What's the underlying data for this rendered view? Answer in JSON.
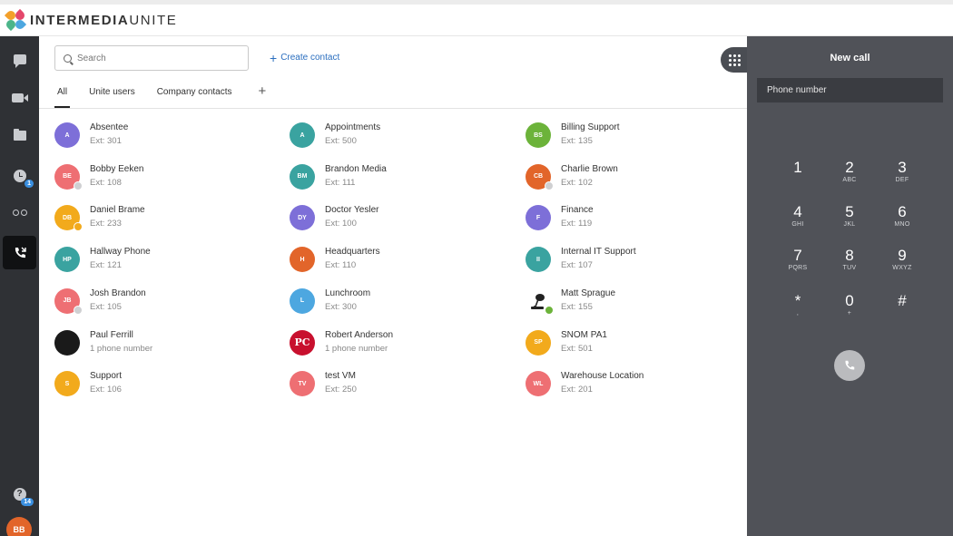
{
  "app": {
    "brand_bold": "INTERMEDIA",
    "brand_light": "UNITE"
  },
  "nav": {
    "recents_badge": "1",
    "help_badge": "14",
    "user_initials": "BB"
  },
  "search": {
    "placeholder": "Search",
    "value": ""
  },
  "create_contact_label": "Create contact",
  "tabs": [
    {
      "label": "All",
      "active": true
    },
    {
      "label": "Unite users"
    },
    {
      "label": "Company contacts"
    }
  ],
  "tab_add_label": "+",
  "contacts": [
    {
      "name": "Absentee",
      "sub": "Ext: 301",
      "initials": "A",
      "color": "#7d6fd8"
    },
    {
      "name": "Appointments",
      "sub": "Ext: 500",
      "initials": "A",
      "color": "#3aa3a0"
    },
    {
      "name": "Billing Support",
      "sub": "Ext: 135",
      "initials": "BS",
      "color": "#6cb33a"
    },
    {
      "name": "Bobby Eeken",
      "sub": "Ext: 108",
      "initials": "BE",
      "color": "#ee6f73",
      "status": "#cfd0d2"
    },
    {
      "name": "Brandon Media",
      "sub": "Ext: 111",
      "initials": "BM",
      "color": "#3aa3a0"
    },
    {
      "name": "Charlie Brown",
      "sub": "Ext: 102",
      "initials": "CB",
      "color": "#e2652a",
      "status": "#cfd0d2"
    },
    {
      "name": "Daniel Brame",
      "sub": "Ext: 233",
      "initials": "DB",
      "color": "#f2aa1c",
      "status": "#f2aa1c"
    },
    {
      "name": "Doctor Yesler",
      "sub": "Ext: 100",
      "initials": "DY",
      "color": "#7d6fd8"
    },
    {
      "name": "Finance",
      "sub": "Ext: 119",
      "initials": "F",
      "color": "#7d6fd8"
    },
    {
      "name": "Hallway Phone",
      "sub": "Ext: 121",
      "initials": "HP",
      "color": "#3aa3a0"
    },
    {
      "name": "Headquarters",
      "sub": "Ext: 110",
      "initials": "H",
      "color": "#e2652a"
    },
    {
      "name": "Internal IT Support",
      "sub": "Ext: 107",
      "initials": "II",
      "color": "#3aa3a0"
    },
    {
      "name": "Josh Brandon",
      "sub": "Ext: 105",
      "initials": "JB",
      "color": "#ee6f73",
      "status": "#cfd0d2"
    },
    {
      "name": "Lunchroom",
      "sub": "Ext: 300",
      "initials": "L",
      "color": "#4da7e0"
    },
    {
      "name": "Matt Sprague",
      "sub": "Ext: 155",
      "initials": "",
      "color": "#ffffff",
      "photo": "matt",
      "status": "#6cb33a"
    },
    {
      "name": "Paul Ferrill",
      "sub": "1 phone number",
      "initials": "",
      "color": "#1a1a1a",
      "photo": "paul"
    },
    {
      "name": "Robert Anderson",
      "sub": "1 phone number",
      "initials": "PC",
      "color": "#c8102e",
      "photo": "pc"
    },
    {
      "name": "SNOM PA1",
      "sub": "Ext: 501",
      "initials": "SP",
      "color": "#f2aa1c"
    },
    {
      "name": "Support",
      "sub": "Ext: 106",
      "initials": "S",
      "color": "#f2aa1c"
    },
    {
      "name": "test VM",
      "sub": "Ext: 250",
      "initials": "TV",
      "color": "#ee6f73"
    },
    {
      "name": "Warehouse Location",
      "sub": "Ext: 201",
      "initials": "WL",
      "color": "#ee6f73"
    }
  ],
  "callpanel": {
    "title": "New call",
    "phone_placeholder": "Phone number",
    "keys": [
      {
        "digit": "1",
        "letters": ""
      },
      {
        "digit": "2",
        "letters": "ABC"
      },
      {
        "digit": "3",
        "letters": "DEF"
      },
      {
        "digit": "4",
        "letters": "GHI"
      },
      {
        "digit": "5",
        "letters": "JKL"
      },
      {
        "digit": "6",
        "letters": "MNO"
      },
      {
        "digit": "7",
        "letters": "PQRS"
      },
      {
        "digit": "8",
        "letters": "TUV"
      },
      {
        "digit": "9",
        "letters": "WXYZ"
      },
      {
        "digit": "*",
        "letters": ","
      },
      {
        "digit": "0",
        "letters": "+"
      },
      {
        "digit": "#",
        "letters": ""
      }
    ]
  }
}
